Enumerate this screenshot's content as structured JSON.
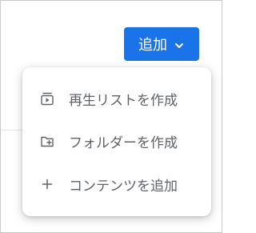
{
  "add_button": {
    "label": "追加",
    "icon": "chevron-down-icon",
    "color": "#1a73e8"
  },
  "menu": {
    "items": [
      {
        "label": "再生リストを作成",
        "icon": "playlist-icon"
      },
      {
        "label": "フォルダーを作成",
        "icon": "folder-add-icon"
      },
      {
        "label": "コンテンツを追加",
        "icon": "plus-icon"
      }
    ]
  }
}
